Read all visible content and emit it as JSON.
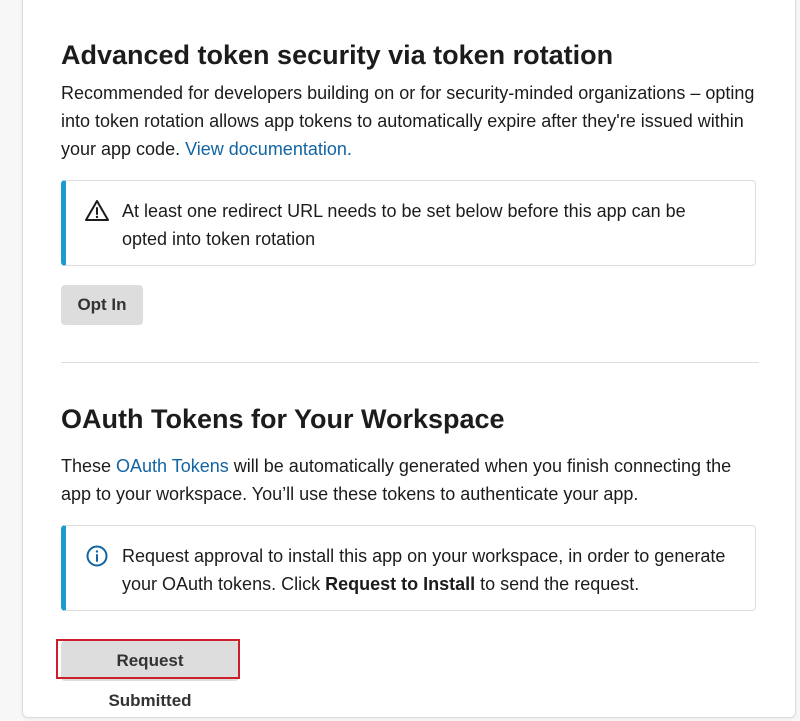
{
  "token_rotation": {
    "title": "Advanced token security via token rotation",
    "description": "Recommended for developers building on or for security-minded organizations – opting into token rotation allows app tokens to automatically expire after they're issued within your app code. ",
    "doc_link": "View documentation.",
    "warning_text": "At least one redirect URL needs to be set below before this app can be opted into token rotation",
    "opt_in_label": "Opt In"
  },
  "oauth": {
    "title": "OAuth Tokens for Your Workspace",
    "desc_prefix": "These ",
    "desc_link": "OAuth Tokens",
    "desc_suffix": " will be automatically generated when you finish connecting the app to your workspace. You’ll use these tokens to authenticate your app.",
    "info_prefix": "Request approval to install this app on your workspace, in order to generate your OAuth tokens. Click ",
    "info_bold": "Request to Install",
    "info_suffix": " to send the request.",
    "request_button_label": "Request Submitted"
  },
  "colors": {
    "link": "#1264a3",
    "callout_accent": "#1d9bd1",
    "highlight": "#cc1f2a"
  },
  "icons": {
    "warning": "warning-triangle-icon",
    "info": "info-circle-icon"
  }
}
